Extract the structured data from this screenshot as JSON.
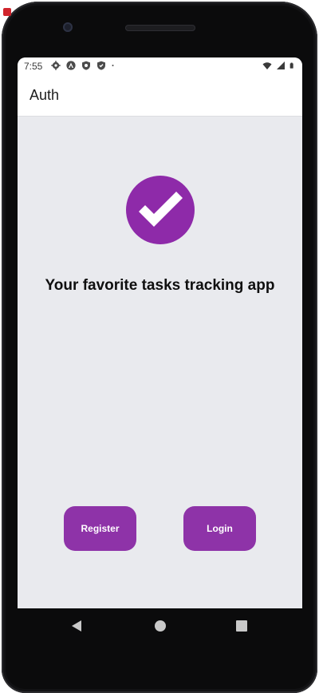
{
  "status_bar": {
    "time": "7:55",
    "left_icons": [
      "gear-icon",
      "android-auto-icon",
      "shield-icon",
      "shield-icon",
      "dot-icon"
    ],
    "right_icons": [
      "wifi-icon",
      "signal-icon",
      "battery-icon"
    ]
  },
  "app_bar": {
    "title": "Auth"
  },
  "hero": {
    "logo_icon": "check-circle-icon",
    "tagline": "Your favorite tasks tracking app"
  },
  "actions": {
    "register_label": "Register",
    "login_label": "Login"
  },
  "navigation": {
    "icons": [
      "back-icon",
      "home-icon",
      "recents-icon"
    ]
  },
  "colors": {
    "accent": "#8e33a8",
    "background": "#e9eaee",
    "app_bar": "#ffffff"
  }
}
